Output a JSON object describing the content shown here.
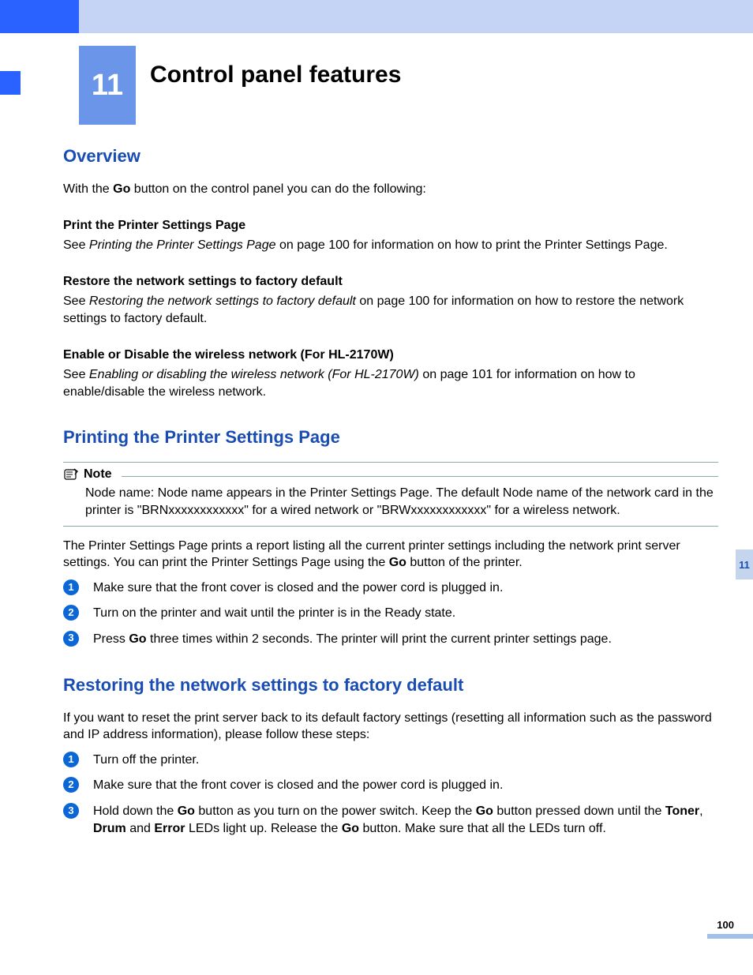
{
  "chapter": {
    "number": "11",
    "title": "Control panel features"
  },
  "overview": {
    "heading": "Overview",
    "intro_a": "With the ",
    "intro_b": " button on the control panel you can do the following:",
    "go": "Go",
    "items": [
      {
        "title": "Print the Printer Settings Page",
        "pre": "See ",
        "link": "Printing the Printer Settings Page",
        "post": " on page 100 for information on how to print the Printer Settings Page."
      },
      {
        "title": "Restore the network settings to factory default",
        "pre": "See ",
        "link": "Restoring the network settings to factory default",
        "post": " on page 100 for information on how to restore the network settings to factory default."
      },
      {
        "title": "Enable or Disable the wireless network (For HL-2170W)",
        "pre": "See ",
        "link": "Enabling or disabling the wireless network (For HL-2170W)",
        "post": " on page 101 for information on how to enable/disable the wireless network."
      }
    ]
  },
  "printing": {
    "heading": "Printing the Printer Settings Page",
    "note_label": "Note",
    "note_body": "Node name: Node name appears in the Printer Settings Page. The default Node name of the network card in the printer is \"BRNxxxxxxxxxxxx\" for a wired network or \"BRWxxxxxxxxxxxx\" for a wireless network.",
    "desc_a": "The Printer Settings Page prints a report listing all the current printer settings including the network print server settings. You can print the Printer Settings Page using the ",
    "desc_b": " button of the printer.",
    "go": "Go",
    "steps": [
      "Make sure that the front cover is closed and the power cord is plugged in.",
      "Turn on the printer and wait until the printer is in the Ready state."
    ],
    "step3_a": "Press ",
    "step3_go": "Go",
    "step3_b": " three times within 2 seconds. The printer will print the current printer settings page."
  },
  "restoring": {
    "heading": "Restoring the network settings to factory default",
    "desc": "If you want to reset the print server back to its default factory settings (resetting all information such as the password and IP address information), please follow these steps:",
    "steps": [
      "Turn off the printer.",
      "Make sure that the front cover is closed and the power cord is plugged in."
    ],
    "step3": {
      "a": "Hold down the ",
      "go1": "Go",
      "b": " button as you turn on the power switch. Keep the ",
      "go2": "Go",
      "c": " button pressed down until the ",
      "t": "Toner",
      "comma": ", ",
      "d": "Drum",
      "and": " and ",
      "e": "Error",
      "f": " LEDs light up. Release the ",
      "go3": "Go",
      "g": " button. Make sure that all the LEDs turn off."
    }
  },
  "sidebar_tab": "11",
  "page_number": "100"
}
